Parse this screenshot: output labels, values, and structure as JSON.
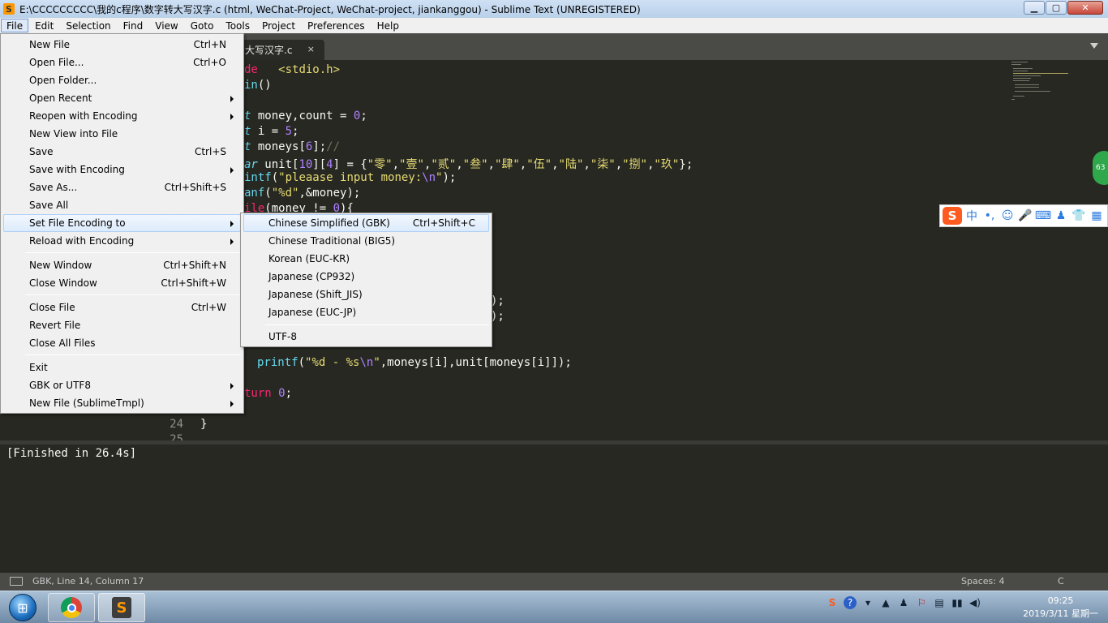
{
  "window": {
    "title": "E:\\CCCCCCCCC\\我的c程序\\数字转大写汉字.c (html, WeChat-Project, WeChat-project, jiankanggou) - Sublime Text (UNREGISTERED)",
    "app_icon_glyph": "S",
    "minimize_glyph": "▁",
    "maximize_glyph": "▢",
    "close_glyph": "✕"
  },
  "menubar": [
    "File",
    "Edit",
    "Selection",
    "Find",
    "View",
    "Goto",
    "Tools",
    "Project",
    "Preferences",
    "Help"
  ],
  "tab": {
    "label": "大写汉字.c",
    "close_glyph": "×"
  },
  "file_menu": [
    {
      "label": "New File",
      "key": "Ctrl+N"
    },
    {
      "label": "Open File...",
      "key": "Ctrl+O"
    },
    {
      "label": "Open Folder...",
      "key": ""
    },
    {
      "label": "Open Recent",
      "key": "",
      "submenu": true
    },
    {
      "label": "Reopen with Encoding",
      "key": "",
      "submenu": true
    },
    {
      "label": "New View into File",
      "key": ""
    },
    {
      "label": "Save",
      "key": "Ctrl+S"
    },
    {
      "label": "Save with Encoding",
      "key": "",
      "submenu": true
    },
    {
      "label": "Save As...",
      "key": "Ctrl+Shift+S"
    },
    {
      "label": "Save All",
      "key": ""
    },
    {
      "label": "Set File Encoding to",
      "key": "",
      "submenu": true,
      "highlighted": true
    },
    {
      "label": "Reload with Encoding",
      "key": "",
      "submenu": true
    },
    {
      "label": "New Window",
      "key": "Ctrl+Shift+N"
    },
    {
      "label": "Close Window",
      "key": "Ctrl+Shift+W"
    },
    {
      "label": "Close File",
      "key": "Ctrl+W"
    },
    {
      "label": "Revert File",
      "key": ""
    },
    {
      "label": "Close All Files",
      "key": ""
    },
    {
      "label": "Exit",
      "key": ""
    },
    {
      "label": "GBK or UTF8",
      "key": "",
      "submenu": true
    },
    {
      "label": "New File (SublimeTmpl)",
      "key": "",
      "submenu": true
    }
  ],
  "encoding_menu": [
    {
      "label": "Chinese Simplified (GBK)",
      "key": "Ctrl+Shift+C",
      "highlighted": true
    },
    {
      "label": "Chinese Traditional (BIG5)",
      "key": ""
    },
    {
      "label": "Korean (EUC-KR)",
      "key": ""
    },
    {
      "label": "Japanese (CP932)",
      "key": ""
    },
    {
      "label": "Japanese (Shift_JIS)",
      "key": ""
    },
    {
      "label": "Japanese (EUC-JP)",
      "key": ""
    },
    {
      "label": "UTF-8",
      "key": ""
    }
  ],
  "code": {
    "line1": [
      [
        "kw",
        "de"
      ],
      [
        "",
        "   "
      ],
      [
        "st",
        "<stdio.h>"
      ]
    ],
    "line2": [
      [
        "fn",
        "in"
      ],
      [
        "",
        "()"
      ]
    ],
    "line3": [
      [
        "tp",
        "t"
      ],
      [
        "",
        " money,count = "
      ],
      [
        "nm",
        "0"
      ],
      [
        "",
        ";"
      ]
    ],
    "line4": [
      [
        "tp",
        "t"
      ],
      [
        "",
        " i = "
      ],
      [
        "nm",
        "5"
      ],
      [
        "",
        ";"
      ]
    ],
    "line5": [
      [
        "tp",
        "t"
      ],
      [
        "",
        " moneys["
      ],
      [
        "nm",
        "6"
      ],
      [
        "",
        "];"
      ],
      [
        "cm",
        "//"
      ]
    ],
    "line6": [
      [
        "tp",
        "ar"
      ],
      [
        "",
        " unit["
      ],
      [
        "nm",
        "10"
      ],
      [
        "",
        "]["
      ],
      [
        "nm",
        "4"
      ],
      [
        "",
        "] = {"
      ],
      [
        "st",
        "\"零\""
      ],
      [
        "",
        ","
      ],
      [
        "st",
        "\"壹\""
      ],
      [
        "",
        ","
      ],
      [
        "st",
        "\"贰\""
      ],
      [
        "",
        ","
      ],
      [
        "st",
        "\"叁\""
      ],
      [
        "",
        ","
      ],
      [
        "st",
        "\"肆\""
      ],
      [
        "",
        ","
      ],
      [
        "st",
        "\"伍\""
      ],
      [
        "",
        ","
      ],
      [
        "st",
        "\"陆\""
      ],
      [
        "",
        ","
      ],
      [
        "st",
        "\"柒\""
      ],
      [
        "",
        ","
      ],
      [
        "st",
        "\"捌\""
      ],
      [
        "",
        ","
      ],
      [
        "st",
        "\"玖\""
      ],
      [
        "",
        "};"
      ]
    ],
    "line7": [
      [
        "fn",
        "intf"
      ],
      [
        "",
        "("
      ],
      [
        "st",
        "\"pleaase input money:"
      ],
      [
        "nm",
        "\\n"
      ],
      [
        "st",
        "\""
      ],
      [
        "",
        ");"
      ]
    ],
    "line8": [
      [
        "fn",
        "anf"
      ],
      [
        "",
        "("
      ],
      [
        "st",
        "\"%d\""
      ],
      [
        "",
        ",&money);"
      ]
    ],
    "line9": [
      [
        "kw",
        "ile"
      ],
      [
        "",
        "(money != "
      ],
      [
        "nm",
        "0"
      ],
      [
        "",
        "){"
      ]
    ],
    "line10": [
      [
        "",
        ");"
      ]
    ],
    "line11": [
      [
        "",
        ");"
      ]
    ],
    "line12": [
      [
        "",
        ""
      ],
      [
        "fn",
        "printf"
      ],
      [
        "",
        "("
      ],
      [
        "st",
        "\"%d - %s"
      ],
      [
        "nm",
        "\\n"
      ],
      [
        "st",
        "\""
      ],
      [
        "",
        ",moneys[i],unit[moneys[i]]);"
      ]
    ],
    "line13": [
      [
        "kw",
        "turn"
      ],
      [
        "",
        " "
      ],
      [
        "nm",
        "0"
      ],
      [
        "",
        ";"
      ]
    ],
    "line14": [
      [
        "",
        "}"
      ]
    ],
    "lnum24": "24",
    "lnum25": "25"
  },
  "scroll_badge": "63",
  "ime": {
    "logo": "S",
    "mode": "中",
    "punct": "•,",
    "emoji": "☺",
    "mic": "🎤",
    "keyboard": "⌨",
    "user": "♟",
    "shirt": "👕",
    "grid": "▦"
  },
  "output": {
    "text": "[Finished in 26.4s]"
  },
  "statusbar": {
    "position": "GBK, Line 14, Column 17",
    "indent": "Spaces: 4",
    "syntax": "C"
  },
  "taskbar": {
    "start_glyph": "⊞",
    "clock_time": "09:25",
    "clock_date": "2019/3/11 星期一",
    "tray_icons": [
      "S",
      "?",
      "▾",
      "▲",
      "♟",
      "⚐",
      "▤",
      "▮▮",
      "◀)"
    ]
  }
}
